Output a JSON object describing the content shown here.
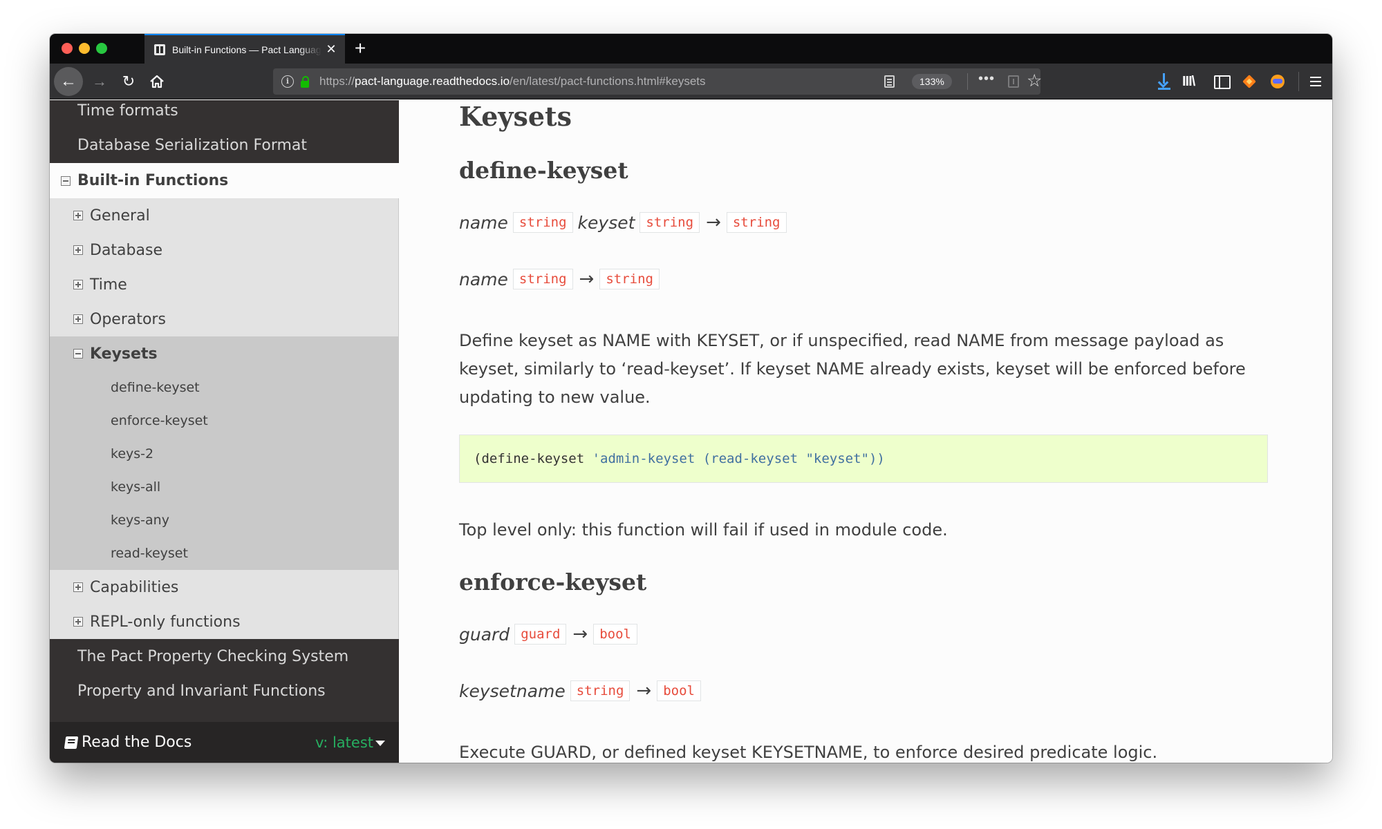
{
  "browser": {
    "tab_title": "Built-in Functions — Pact Language",
    "tab_close": "✕",
    "new_tab": "+",
    "url_scheme": "https://",
    "url_host": "pact-language.readthedocs.io",
    "url_path": "/en/latest/pact-functions.html#keysets",
    "zoom": "133%",
    "more": "•••",
    "star": "☆",
    "library": "III\\",
    "back": "←",
    "forward": "→",
    "reload": "↻",
    "info": "i",
    "accent_color": "#0a84ff"
  },
  "sidebar": {
    "top_items": [
      "Time formats",
      "Database Serialization Format"
    ],
    "current": "Built-in Functions",
    "sections": [
      {
        "label": "General",
        "expanded": false
      },
      {
        "label": "Database",
        "expanded": false
      },
      {
        "label": "Time",
        "expanded": false
      },
      {
        "label": "Operators",
        "expanded": false
      },
      {
        "label": "Keysets",
        "expanded": true
      }
    ],
    "keyset_items": [
      "define-keyset",
      "enforce-keyset",
      "keys-2",
      "keys-all",
      "keys-any",
      "read-keyset"
    ],
    "after_sections": [
      {
        "label": "Capabilities",
        "expanded": false
      },
      {
        "label": "REPL-only functions",
        "expanded": false
      }
    ],
    "bottom_items": [
      "The Pact Property Checking System",
      "Property and Invariant Functions"
    ],
    "footer": {
      "label": "Read the Docs",
      "version": "v: latest"
    },
    "version_color": "#27ae60"
  },
  "content": {
    "section_title": "Keysets",
    "define_keyset": {
      "title": "define-keyset",
      "sig1": {
        "arg1": "name",
        "type1": "string",
        "arg2": "keyset",
        "type2": "string",
        "arrow": "→",
        "ret": "string"
      },
      "sig2": {
        "arg1": "name",
        "type1": "string",
        "arrow": "→",
        "ret": "string"
      },
      "description": [
        "Define keyset as NAME with KEYSET, or if unspecified, read NAME from message payload as",
        "keyset, similarly to ‘read-keyset’. If keyset NAME already exists, keyset will be enforced before",
        "updating to new value."
      ],
      "code_open": "(define-keyset ",
      "code_quoted": "'admin-keyset (read-keyset \"keyset\"))",
      "note": "Top level only: this function will fail if used in module code."
    },
    "enforce_keyset": {
      "title": "enforce-keyset",
      "sig1": {
        "arg1": "guard",
        "type1": "guard",
        "arrow": "→",
        "ret": "bool"
      },
      "sig2": {
        "arg1": "keysetname",
        "type1": "string",
        "arrow": "→",
        "ret": "bool"
      },
      "description": "Execute GUARD, or defined keyset KEYSETNAME, to enforce desired predicate logic."
    },
    "code_chip_color": "#e74c3c",
    "code_block_bg": "#eeffcc"
  }
}
